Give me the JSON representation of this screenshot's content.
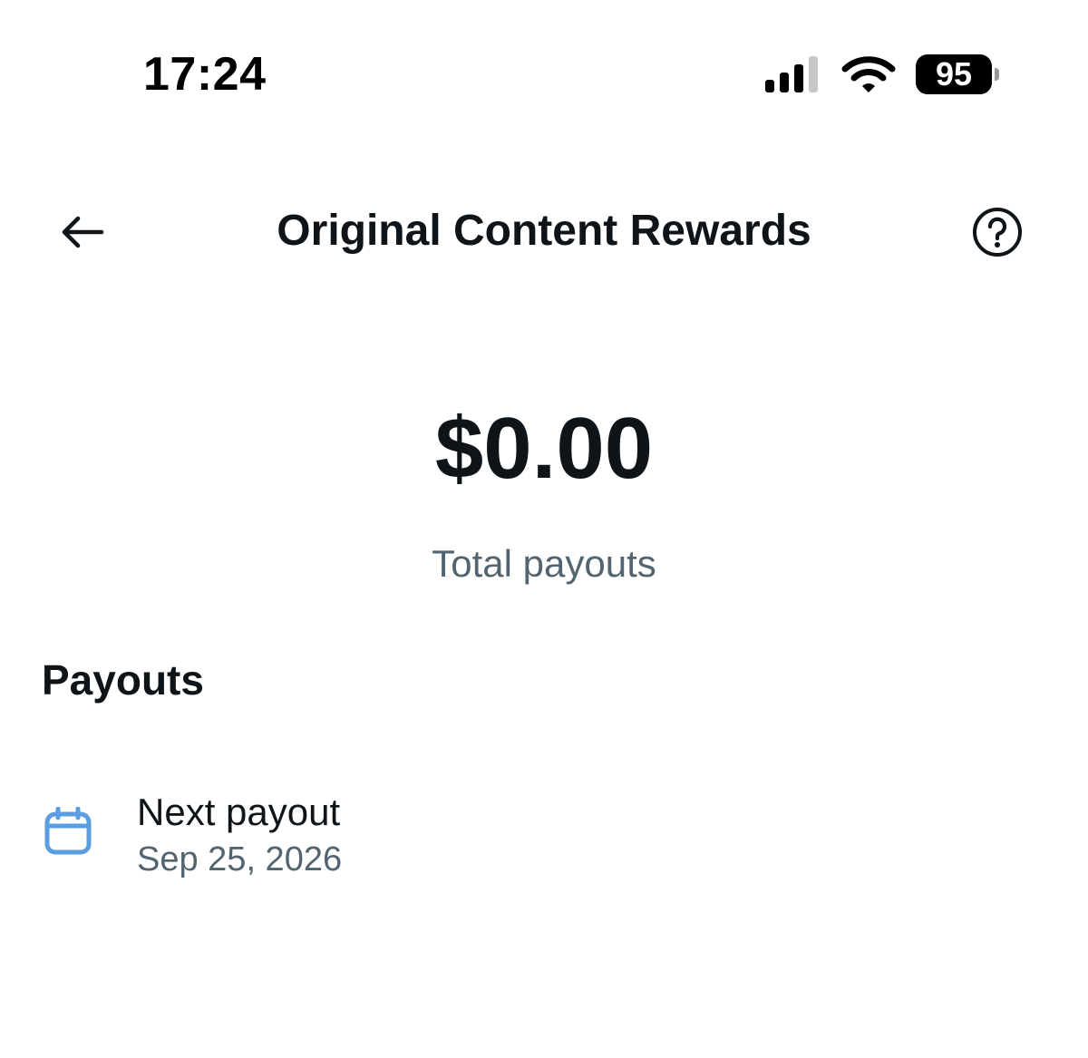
{
  "status_bar": {
    "time": "17:24",
    "battery_level": "95",
    "signal_icon": "cellular-signal-icon",
    "wifi_icon": "wifi-icon"
  },
  "header": {
    "title": "Original Content Rewards",
    "back_icon": "arrow-left-icon",
    "help_icon": "question-circle-icon"
  },
  "summary": {
    "amount": "$0.00",
    "caption": "Total payouts"
  },
  "payouts": {
    "heading": "Payouts",
    "items": [
      {
        "icon": "calendar-icon",
        "label": "Next payout",
        "date": "Sep 25, 2026"
      }
    ]
  },
  "colors": {
    "text_primary": "#0f1419",
    "text_secondary": "#536471",
    "accent": "#5b9ee0"
  }
}
